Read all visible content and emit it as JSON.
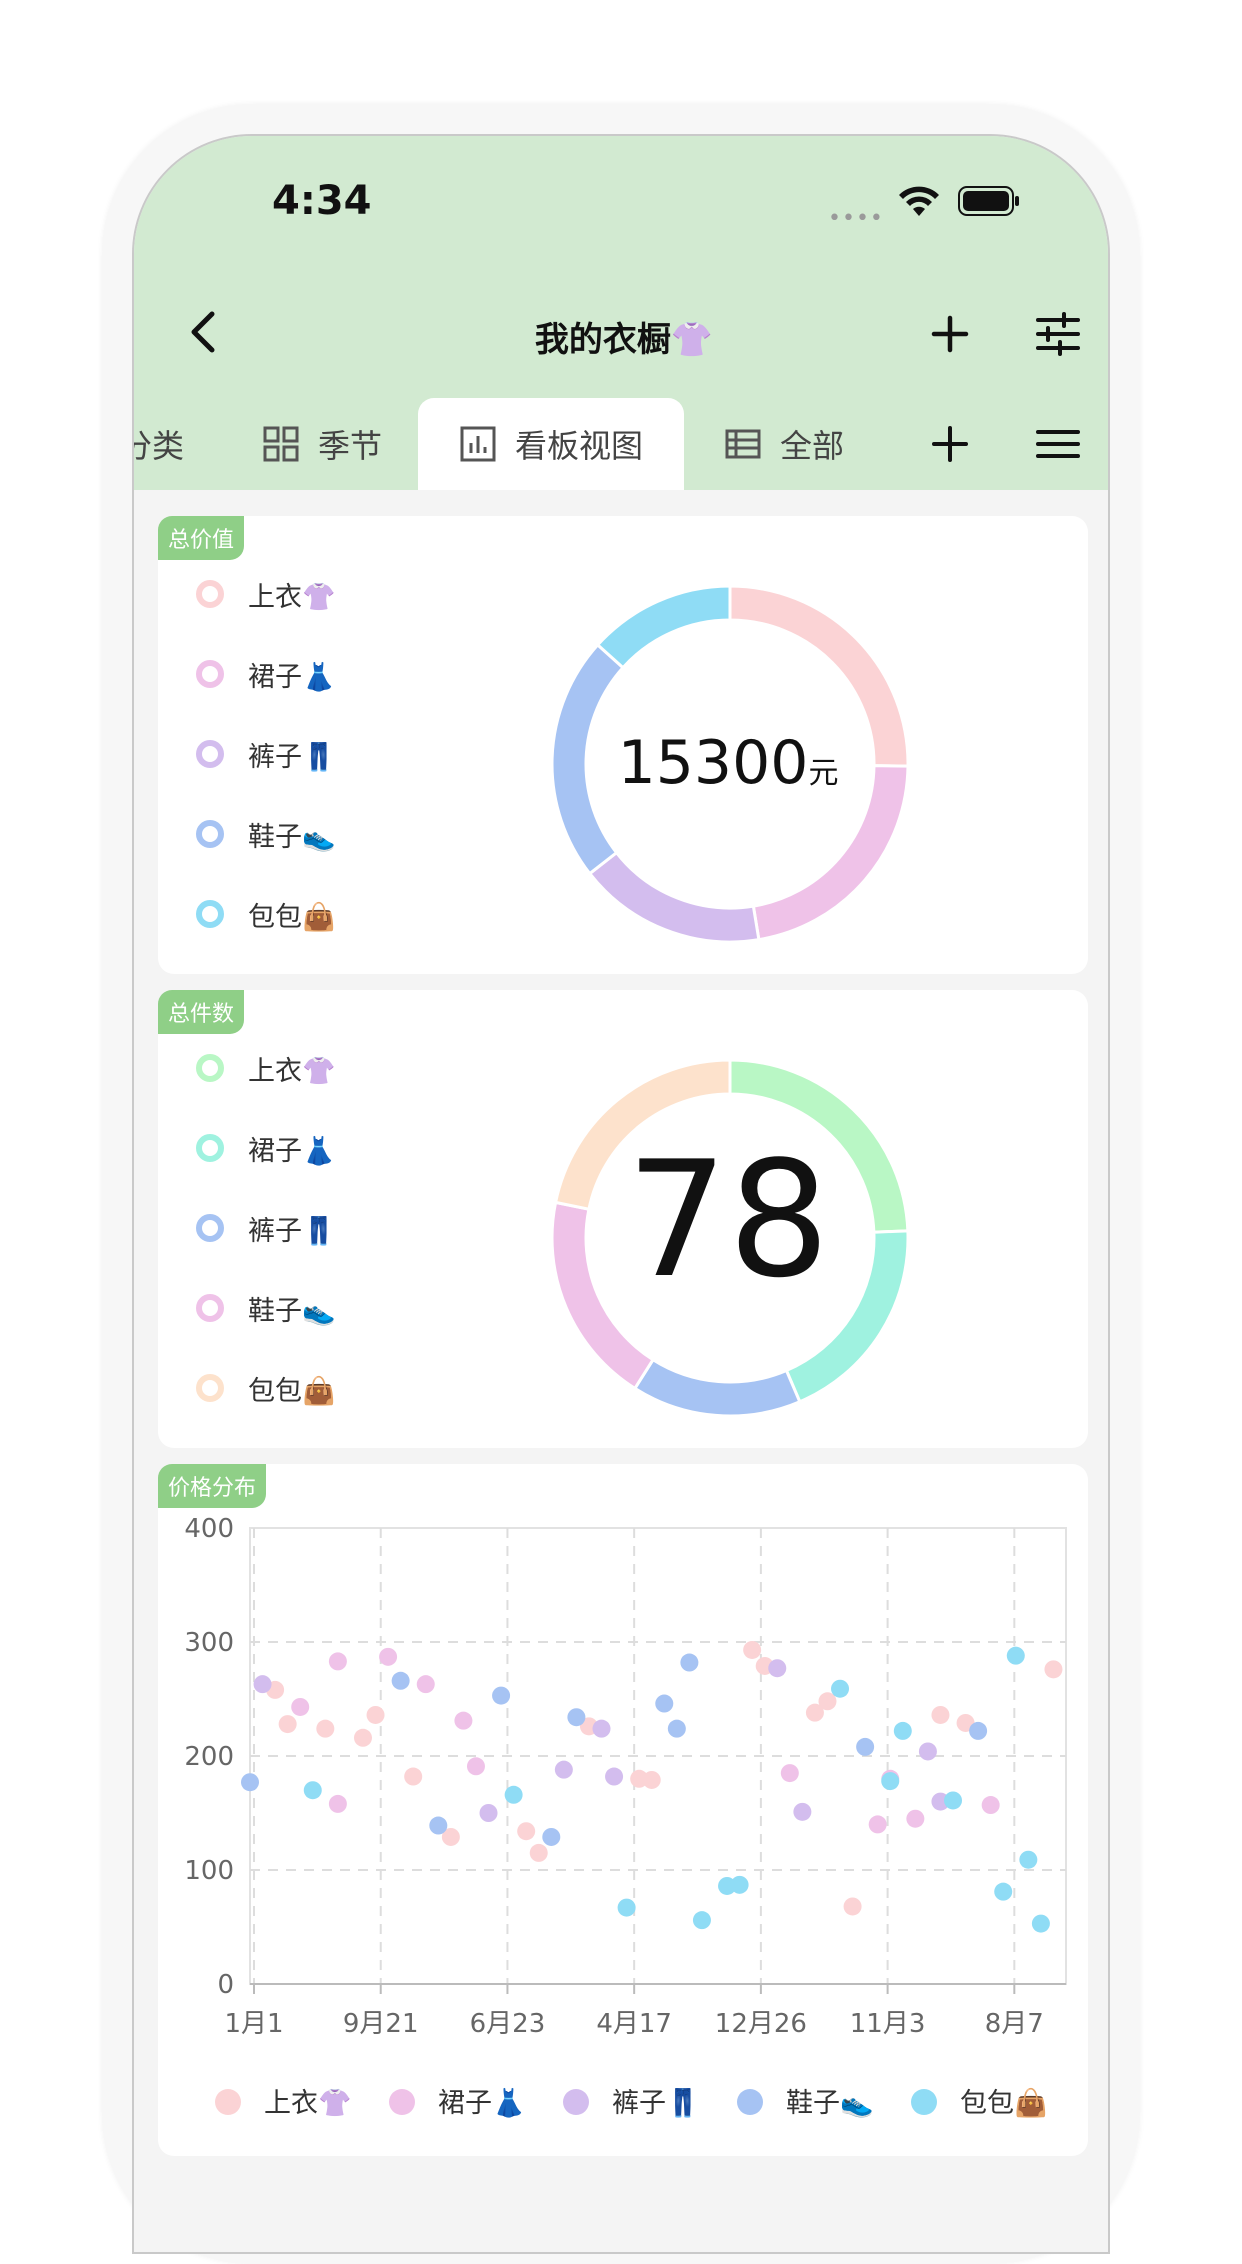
{
  "status": {
    "time": "4:34",
    "dots": "••••"
  },
  "nav": {
    "title": "我的衣橱👚"
  },
  "tabs": [
    {
      "label": "分类",
      "active": false
    },
    {
      "label": "季节",
      "active": false
    },
    {
      "label": "看板视图",
      "active": true
    },
    {
      "label": "全部",
      "active": false
    }
  ],
  "colors": {
    "header": "#d2ead1",
    "tag": "#8fcf87",
    "pink": "#fbd3d5",
    "orchid": "#efc2e8",
    "lavender": "#d3bdee",
    "blue": "#a6c3f3",
    "cyan": "#8fdcf5",
    "mint": "#9ff2e0",
    "green": "#b9f7c5",
    "peach": "#fde2cc"
  },
  "cards": {
    "total_value": {
      "tag": "总价值",
      "center_number": "15300",
      "center_unit": "元",
      "legend": [
        "上衣👚",
        "裙子👗",
        "裤子👖",
        "鞋子👟",
        "包包👜"
      ]
    },
    "total_count": {
      "tag": "总件数",
      "center_number": "78",
      "legend": [
        "上衣👚",
        "裙子👗",
        "裤子👖",
        "鞋子👟",
        "包包👜"
      ]
    },
    "price_dist": {
      "tag": "价格分布",
      "legend": [
        "上衣👚",
        "裙子👗",
        "裤子👖",
        "鞋子👟",
        "包包👜"
      ]
    }
  },
  "chart_data": [
    {
      "type": "pie",
      "title": "总价值",
      "center_text": "15300元",
      "categories": [
        "上衣👚",
        "裙子👗",
        "裤子👖",
        "鞋子👟",
        "包包👜"
      ],
      "values": [
        3400,
        3000,
        2300,
        3000,
        1800
      ],
      "colors": [
        "#fbd3d5",
        "#efc2e8",
        "#d3bdee",
        "#a6c3f3",
        "#8fdcf5"
      ],
      "donut": true
    },
    {
      "type": "pie",
      "title": "总件数",
      "center_text": "78",
      "categories": [
        "上衣👚",
        "裙子👗",
        "裤子👖",
        "鞋子👟",
        "包包👜"
      ],
      "values": [
        19,
        15,
        12,
        15,
        17
      ],
      "colors": [
        "#b9f7c5",
        "#9ff2e0",
        "#a6c3f3",
        "#efc2e8",
        "#fde2cc"
      ],
      "donut": true
    },
    {
      "type": "scatter",
      "title": "价格分布",
      "x_tick_labels": [
        "1月1",
        "9月21",
        "6月23",
        "4月17",
        "12月26",
        "11月3",
        "8月7"
      ],
      "x_range": [
        0,
        65
      ],
      "ylim": [
        0,
        400
      ],
      "y_ticks": [
        0,
        100,
        200,
        300,
        400
      ],
      "grid": true,
      "legend_position": "bottom",
      "series": [
        {
          "name": "上衣👚",
          "color": "#fbd3d5",
          "points": [
            [
              2,
              258
            ],
            [
              3,
              228
            ],
            [
              6,
              224
            ],
            [
              9,
              216
            ],
            [
              10,
              236
            ],
            [
              13,
              182
            ],
            [
              16,
              129
            ],
            [
              22,
              134
            ],
            [
              23,
              115
            ],
            [
              27,
              226
            ],
            [
              31,
              180
            ],
            [
              32,
              179
            ],
            [
              40,
              293
            ],
            [
              41,
              279
            ],
            [
              45,
              238
            ],
            [
              46,
              248
            ],
            [
              48,
              68
            ],
            [
              55,
              236
            ],
            [
              57,
              229
            ],
            [
              64,
              276
            ]
          ]
        },
        {
          "name": "裙子👗",
          "color": "#efc2e8",
          "points": [
            [
              4,
              243
            ],
            [
              7,
              158
            ],
            [
              7,
              283
            ],
            [
              11,
              287
            ],
            [
              14,
              263
            ],
            [
              17,
              231
            ],
            [
              18,
              191
            ],
            [
              43,
              185
            ],
            [
              50,
              140
            ],
            [
              51,
              180
            ],
            [
              53,
              145
            ],
            [
              59,
              157
            ]
          ]
        },
        {
          "name": "裤子👖",
          "color": "#d3bdee",
          "points": [
            [
              1,
              263
            ],
            [
              19,
              150
            ],
            [
              25,
              188
            ],
            [
              28,
              224
            ],
            [
              29,
              182
            ],
            [
              42,
              277
            ],
            [
              44,
              151
            ],
            [
              54,
              204
            ],
            [
              55,
              160
            ]
          ]
        },
        {
          "name": "鞋子👟",
          "color": "#a6c3f3",
          "points": [
            [
              0,
              177
            ],
            [
              12,
              266
            ],
            [
              15,
              139
            ],
            [
              20,
              253
            ],
            [
              24,
              129
            ],
            [
              26,
              234
            ],
            [
              33,
              246
            ],
            [
              34,
              224
            ],
            [
              35,
              282
            ],
            [
              49,
              208
            ],
            [
              58,
              222
            ]
          ]
        },
        {
          "name": "包包👜",
          "color": "#8fdcf5",
          "points": [
            [
              5,
              170
            ],
            [
              21,
              166
            ],
            [
              30,
              67
            ],
            [
              36,
              56
            ],
            [
              38,
              86
            ],
            [
              39,
              87
            ],
            [
              47,
              259
            ],
            [
              51,
              178
            ],
            [
              52,
              222
            ],
            [
              56,
              161
            ],
            [
              60,
              81
            ],
            [
              61,
              288
            ],
            [
              62,
              109
            ],
            [
              63,
              53
            ]
          ]
        }
      ]
    }
  ]
}
